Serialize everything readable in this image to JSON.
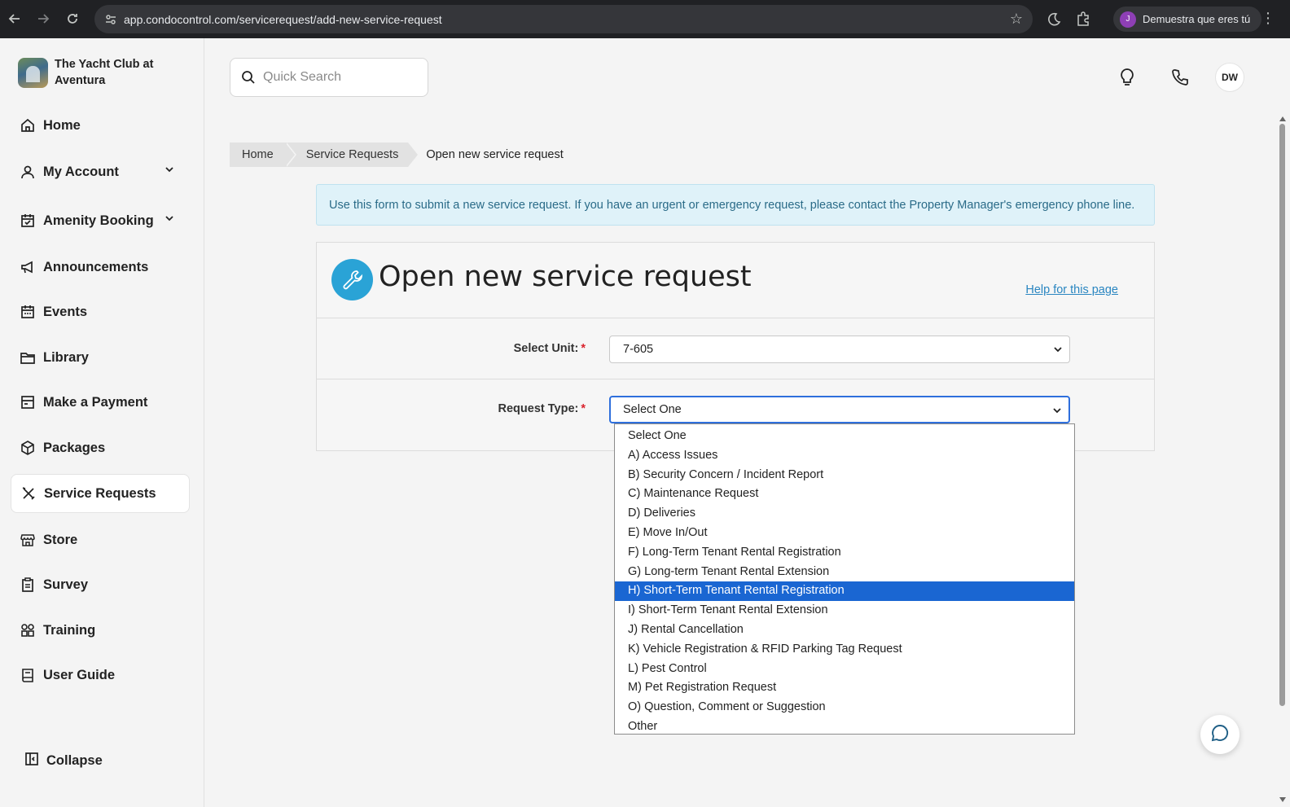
{
  "browser": {
    "url": "app.condocontrol.com/servicerequest/add-new-service-request",
    "profile_initial": "J",
    "profile_text": "Demuestra que eres tú"
  },
  "sidebar": {
    "brand": "The Yacht Club at Aventura",
    "items": [
      {
        "label": "Home",
        "icon": "home-icon"
      },
      {
        "label": "My Account",
        "icon": "user-icon",
        "expandable": true
      },
      {
        "label": "Amenity Booking",
        "icon": "calendar-check-icon",
        "expandable": true
      },
      {
        "label": "Announcements",
        "icon": "megaphone-icon"
      },
      {
        "label": "Events",
        "icon": "calendar-icon"
      },
      {
        "label": "Library",
        "icon": "folder-icon"
      },
      {
        "label": "Make a Payment",
        "icon": "payment-icon"
      },
      {
        "label": "Packages",
        "icon": "package-icon"
      },
      {
        "label": "Service Requests",
        "icon": "tools-icon",
        "active": true
      },
      {
        "label": "Store",
        "icon": "store-icon"
      },
      {
        "label": "Survey",
        "icon": "clipboard-icon"
      },
      {
        "label": "Training",
        "icon": "people-icon"
      },
      {
        "label": "User Guide",
        "icon": "book-icon"
      }
    ],
    "collapse_label": "Collapse"
  },
  "header": {
    "search_placeholder": "Quick Search",
    "avatar_initials": "DW"
  },
  "breadcrumb": {
    "home": "Home",
    "section": "Service Requests",
    "current": "Open new service request"
  },
  "alert": "Use this form to submit a new service request. If you have an urgent or emergency request, please contact the Property Manager's emergency phone line.",
  "form": {
    "title": "Open new service request",
    "help_link": "Help for this page",
    "unit_label": "Select Unit:",
    "unit_value": "7-605",
    "request_type_label": "Request Type:",
    "request_type_value": "Select One",
    "required_mark": "*"
  },
  "request_type_options": [
    "Select One",
    "A) Access Issues",
    "B) Security Concern / Incident Report",
    "C) Maintenance Request",
    "D) Deliveries",
    "E) Move In/Out",
    "F) Long-Term Tenant Rental Registration",
    "G) Long-term Tenant Rental Extension",
    "H) Short-Term Tenant Rental Registration",
    "I) Short-Term Tenant Rental Extension",
    "J) Rental Cancellation",
    "K) Vehicle Registration & RFID Parking Tag Request",
    "L) Pest Control",
    "M) Pet Registration Request",
    "O) Question, Comment or Suggestion",
    "Other"
  ],
  "highlighted_option_index": 8,
  "colors": {
    "accent_blue": "#2aa3d6",
    "highlight": "#1a66d2",
    "required": "#d9242e",
    "alert_bg": "#dff2f9"
  }
}
